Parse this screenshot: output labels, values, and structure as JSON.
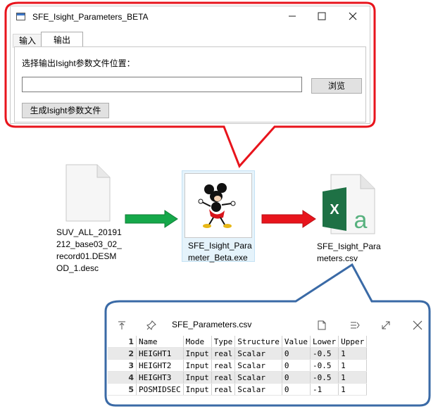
{
  "window": {
    "title": "SFE_Isight_Parameters_BETA",
    "controls": {
      "minimize": "—",
      "maximize": "☐",
      "close": "✕"
    },
    "tabs": [
      {
        "label": "输入"
      },
      {
        "label": "输出"
      }
    ],
    "active_tab": "输出",
    "prompt_label": "选择输出Isight参数文件位置：",
    "path_input": {
      "value": "",
      "placeholder": ""
    },
    "browse_label": "浏览",
    "generate_label": "生成Isight参数文件"
  },
  "files": {
    "input_desc": {
      "lines": [
        "SUV_ALL_20191",
        "212_base03_02_",
        "record01.DESM",
        "OD_1.desc"
      ]
    },
    "exe": {
      "lines": [
        "SFE_Isight_Para",
        "meter_Beta.exe"
      ]
    },
    "csv": {
      "lines": [
        "SFE_Isight_Para",
        "meters.csv"
      ],
      "excel_letter": "X",
      "a_letter": "a"
    }
  },
  "colors": {
    "red_callout": "#e8141c",
    "blue_callout": "#3a6aa6",
    "green_arrow": "#15a84a",
    "red_arrow": "#e8141c",
    "excel_green": "#1e7145",
    "excel_a": "#57b17e"
  },
  "csv_viewer": {
    "title": "SFE_Parameters.csv",
    "icons": [
      "move-to-top-icon",
      "pin-icon",
      "new-file-icon",
      "wrap-icon",
      "expand-icon",
      "close-icon"
    ],
    "headers": [
      "Name",
      "Mode",
      "Type",
      "Structure",
      "Value",
      "Lower",
      "Upper"
    ],
    "rows": [
      {
        "n": "1",
        "cells": [
          "Name",
          "Mode",
          "Type",
          "Structure",
          "Value",
          "Lower",
          "Upper"
        ]
      },
      {
        "n": "2",
        "cells": [
          "HEIGHT1",
          "Input",
          "real",
          "Scalar",
          "0",
          "-0.5",
          "1"
        ]
      },
      {
        "n": "3",
        "cells": [
          "HEIGHT2",
          "Input",
          "real",
          "Scalar",
          "0",
          "-0.5",
          "1"
        ]
      },
      {
        "n": "4",
        "cells": [
          "HEIGHT3",
          "Input",
          "real",
          "Scalar",
          "0",
          "-0.5",
          "1"
        ]
      },
      {
        "n": "5",
        "cells": [
          "POSMIDSEC",
          "Input",
          "real",
          "Scalar",
          "0",
          "-1",
          "1"
        ]
      }
    ]
  }
}
